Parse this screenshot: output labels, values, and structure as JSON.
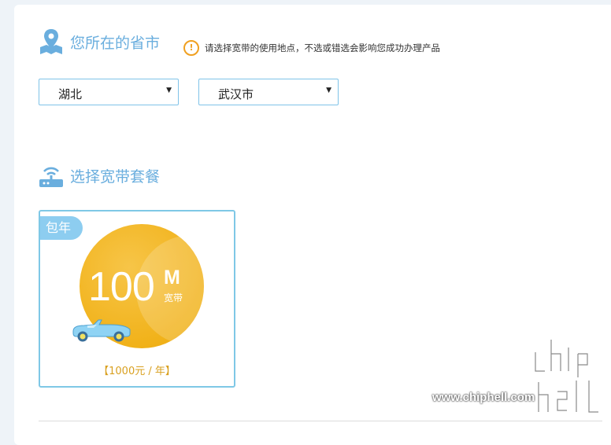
{
  "location": {
    "title": "您所在的省市",
    "hint": "请选择宽带的使用地点，不选或错选会影响您成功办理产品",
    "province_value": "湖北",
    "city_value": "武汉市"
  },
  "package": {
    "title": "选择宽带套餐",
    "cards": [
      {
        "badge": "包年",
        "speed": "100",
        "unit": "M",
        "unit_label": "宽带",
        "price": "【1000元 / 年】"
      }
    ]
  },
  "watermark": {
    "url": "www.chiphell.com"
  },
  "colors": {
    "accent": "#6aaede",
    "warning": "#f0a020",
    "circle": "#f1b21a",
    "badge": "#8dcdf0",
    "select_border": "#7fc3e8"
  },
  "icons": [
    "location-pin-icon",
    "warning-icon",
    "router-icon",
    "dropdown-arrow-icon",
    "car-icon"
  ]
}
